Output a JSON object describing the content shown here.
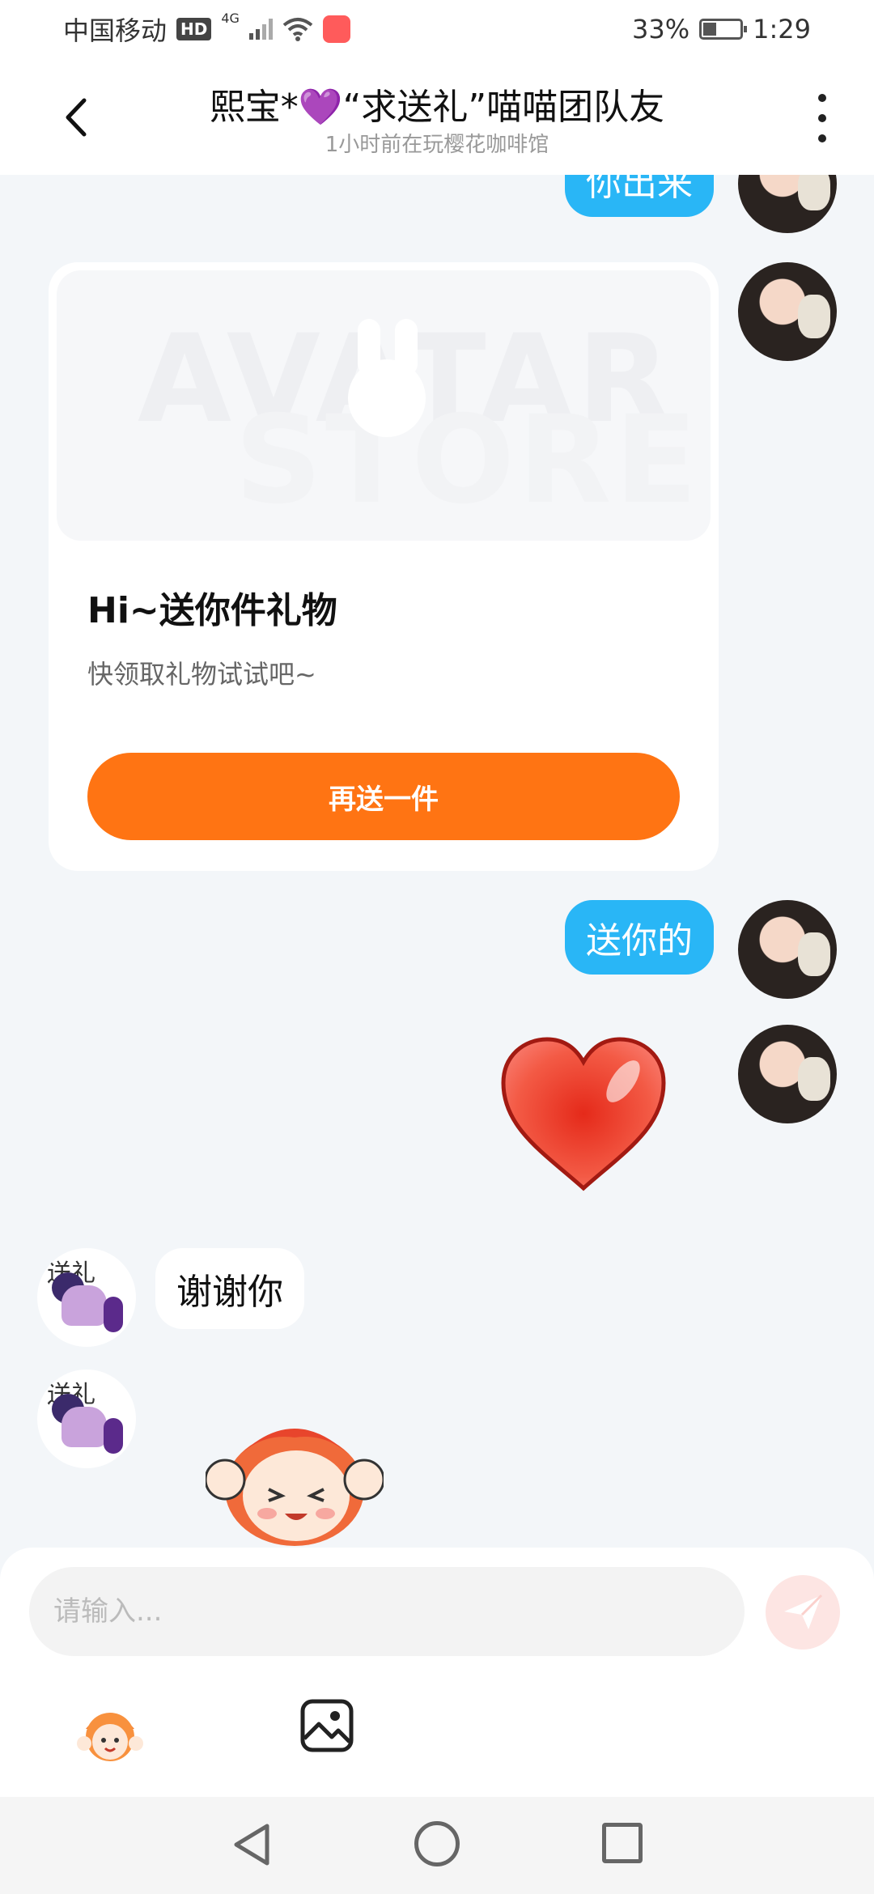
{
  "status_bar": {
    "carrier": "中国移动",
    "hd_badge": "HD",
    "network": "4G",
    "battery_level": "33%",
    "time": "1:29"
  },
  "header": {
    "title": "熙宝*💜“求送礼”喵喵团队友",
    "subtitle": "1小时前在玩樱花咖啡馆",
    "back_icon": "chevron-left-icon",
    "more_icon": "more-vertical-icon"
  },
  "messages": {
    "partial_top_text": "你出来",
    "gift_card": {
      "image_logo_line1": "AVATAR",
      "image_logo_line2": "STORE",
      "title": "Hi~送你件礼物",
      "description": "快领取礼物试试吧~",
      "button_label": "再送一件"
    },
    "sent_text": "送你的",
    "sent_sticker": "red-heart-sticker",
    "received_text": "谢谢你",
    "received_sticker": "cheering-kid-sticker",
    "pony_avatar_text": "送礼"
  },
  "composer": {
    "placeholder": "请输入...",
    "send_icon": "paper-plane-icon",
    "sticker_icon": "character-face-icon",
    "image_icon": "image-icon"
  },
  "colors": {
    "bubble_blue": "#29b6f6",
    "gift_button": "#ff7413",
    "chat_background": "#f3f6f9"
  }
}
